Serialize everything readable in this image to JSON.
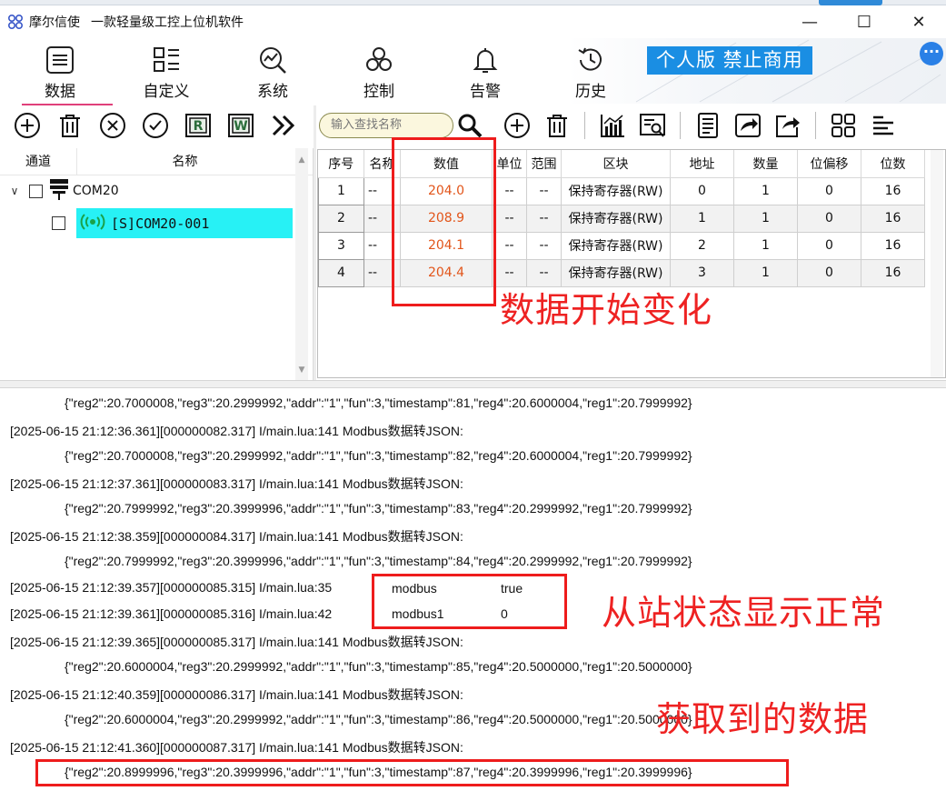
{
  "title_bar": {
    "app_name": "摩尔信使",
    "slogan": "一款轻量级工控上位机软件",
    "minimize": "—",
    "maximize": "☐",
    "close": "✕"
  },
  "nav": {
    "items": [
      {
        "label": "数据",
        "icon": "list-icon"
      },
      {
        "label": "自定义",
        "icon": "grid-icon"
      },
      {
        "label": "系统",
        "icon": "chart-search-icon"
      },
      {
        "label": "控制",
        "icon": "link-icon"
      },
      {
        "label": "告警",
        "icon": "bell-icon"
      },
      {
        "label": "历史",
        "icon": "history-icon"
      }
    ],
    "active": "数据",
    "badge": "个人版  禁止商用",
    "chat_icon": "chat-bubble-icon"
  },
  "left_toolbar": {
    "buttons": [
      "add-icon",
      "delete-icon",
      "close-circle-icon",
      "check-circle-icon",
      "read-r-icon",
      "write-w-icon",
      "double-chevron-icon"
    ],
    "r_label": "R",
    "w_label": "W"
  },
  "tree": {
    "header": {
      "channel": "通道",
      "name": "名称"
    },
    "port": {
      "label": "COM20"
    },
    "device": {
      "label": "[S]COM20-001"
    }
  },
  "right_toolbar": {
    "search_placeholder": "输入查找名称",
    "buttons": [
      "search-icon",
      "add-icon",
      "delete-icon",
      "bar-chart-icon",
      "search-doc-icon",
      "doc-icon",
      "share-icon",
      "export-icon",
      "tiles-icon",
      "align-icon"
    ]
  },
  "grid": {
    "columns": [
      "序号",
      "名称",
      "数值",
      "单位",
      "范围",
      "区块",
      "地址",
      "数量",
      "位偏移",
      "位数"
    ],
    "rows": [
      {
        "no": "1",
        "name": "--",
        "value": "204.0",
        "unit": "--",
        "range": "--",
        "block": "保持寄存器(RW)",
        "addr": "0",
        "qty": "1",
        "bit_offset": "0",
        "bits": "16"
      },
      {
        "no": "2",
        "name": "--",
        "value": "208.9",
        "unit": "--",
        "range": "--",
        "block": "保持寄存器(RW)",
        "addr": "1",
        "qty": "1",
        "bit_offset": "0",
        "bits": "16"
      },
      {
        "no": "3",
        "name": "--",
        "value": "204.1",
        "unit": "--",
        "range": "--",
        "block": "保持寄存器(RW)",
        "addr": "2",
        "qty": "1",
        "bit_offset": "0",
        "bits": "16"
      },
      {
        "no": "4",
        "name": "--",
        "value": "204.4",
        "unit": "--",
        "range": "--",
        "block": "保持寄存器(RW)",
        "addr": "3",
        "qty": "1",
        "bit_offset": "0",
        "bits": "16"
      }
    ]
  },
  "log": {
    "lines": [
      "{\"reg2\":20.7000008,\"reg3\":20.2999992,\"addr\":\"1\",\"fun\":3,\"timestamp\":81,\"reg4\":20.6000004,\"reg1\":20.7999992}",
      "[2025-06-15 21:12:36.361][000000082.317] I/main.lua:141  Modbus数据转JSON:",
      "{\"reg2\":20.7000008,\"reg3\":20.2999992,\"addr\":\"1\",\"fun\":3,\"timestamp\":82,\"reg4\":20.6000004,\"reg1\":20.7999992}",
      "[2025-06-15 21:12:37.361][000000083.317] I/main.lua:141  Modbus数据转JSON:",
      "{\"reg2\":20.7999992,\"reg3\":20.3999996,\"addr\":\"1\",\"fun\":3,\"timestamp\":83,\"reg4\":20.2999992,\"reg1\":20.7999992}",
      "[2025-06-15 21:12:38.359][000000084.317] I/main.lua:141  Modbus数据转JSON:",
      "{\"reg2\":20.7999992,\"reg3\":20.3999996,\"addr\":\"1\",\"fun\":3,\"timestamp\":84,\"reg4\":20.2999992,\"reg1\":20.7999992}",
      "[2025-06-15 21:12:39.357][000000085.315] I/main.lua:35",
      "[2025-06-15 21:12:39.361][000000085.316] I/main.lua:42",
      "[2025-06-15 21:12:39.365][000000085.317] I/main.lua:141  Modbus数据转JSON:",
      "{\"reg2\":20.6000004,\"reg3\":20.2999992,\"addr\":\"1\",\"fun\":3,\"timestamp\":85,\"reg4\":20.5000000,\"reg1\":20.5000000}",
      "[2025-06-15 21:12:40.359][000000086.317] I/main.lua:141  Modbus数据转JSON:",
      "{\"reg2\":20.6000004,\"reg3\":20.2999992,\"addr\":\"1\",\"fun\":3,\"timestamp\":86,\"reg4\":20.5000000,\"reg1\":20.5000000}",
      "[2025-06-15 21:12:41.360][000000087.317] I/main.lua:141  Modbus数据转JSON:",
      "{\"reg2\":20.8999996,\"reg3\":20.3999996,\"addr\":\"1\",\"fun\":3,\"timestamp\":87,\"reg4\":20.3999996,\"reg1\":20.3999996}"
    ],
    "status_box": {
      "k1": "modbus",
      "v1": "true",
      "k2": "modbus1",
      "v2": "0"
    }
  },
  "annotations": {
    "data_changing": "数据开始变化",
    "slave_ok": "从站状态显示正常",
    "got_data": "获取到的数据"
  },
  "colors": {
    "accent": "#1a8ee3",
    "selection": "#27f1f5",
    "value_text": "#e2551a",
    "annotation": "#ee1c1c"
  }
}
